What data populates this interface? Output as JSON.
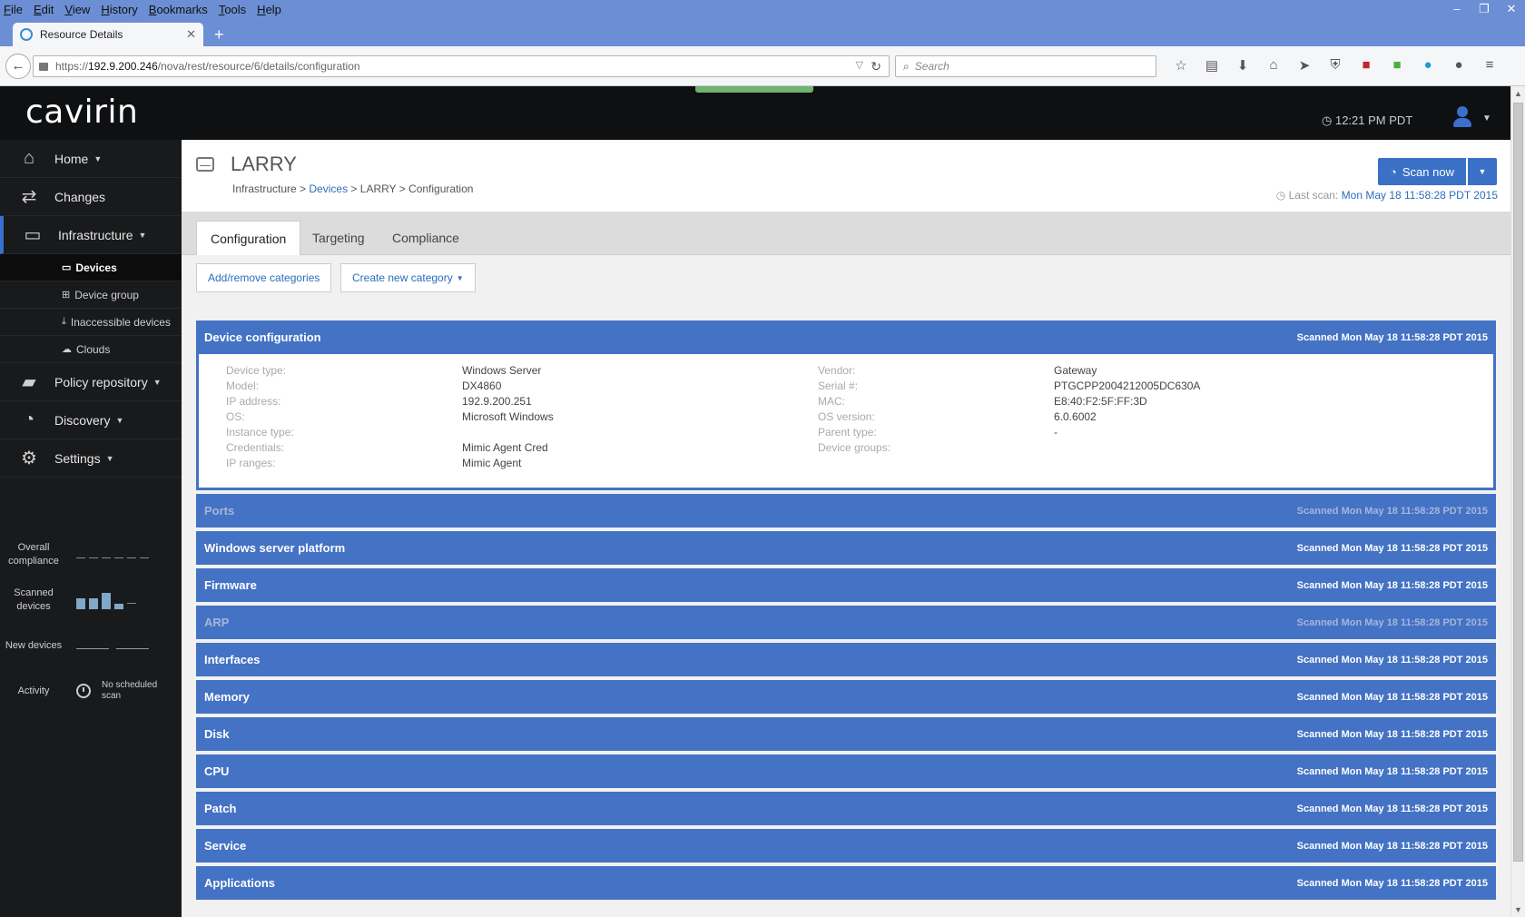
{
  "browser": {
    "menu": [
      "File",
      "Edit",
      "View",
      "History",
      "Bookmarks",
      "Tools",
      "Help"
    ],
    "tab_title": "Resource Details",
    "url_prefix": "https://",
    "url_host": "192.9.200.246",
    "url_path": "/nova/rest/resource/6/details/configuration",
    "search_placeholder": "Search"
  },
  "app": {
    "logo": "cavirin",
    "clock": "12:21 PM PDT"
  },
  "sidebar": {
    "items": [
      {
        "label": "Home",
        "icon": "home-icon"
      },
      {
        "label": "Changes",
        "icon": "changes-icon"
      },
      {
        "label": "Infrastructure",
        "icon": "hdd-icon"
      },
      {
        "label": "Policy repository",
        "icon": "folder-icon"
      },
      {
        "label": "Discovery",
        "icon": "rss-icon"
      },
      {
        "label": "Settings",
        "icon": "gear-icon"
      }
    ],
    "subitems": [
      {
        "label": "Devices",
        "icon": "hdd-icon"
      },
      {
        "label": "Device group",
        "icon": "sitemap-icon"
      },
      {
        "label": "Inaccessible devices",
        "icon": "download-icon"
      },
      {
        "label": "Clouds",
        "icon": "cloud-icon"
      }
    ],
    "stats": {
      "overall": "Overall compliance",
      "scanned": "Scanned devices",
      "new": "New devices",
      "activity": "Activity",
      "schedule": "No scheduled scan"
    }
  },
  "page": {
    "title": "LARRY",
    "crumb_1": "Infrastructure",
    "crumb_2": "Devices",
    "crumb_3": "LARRY",
    "crumb_4": "Configuration",
    "scan_button": "Scan now",
    "last_scan_label": "Last scan:",
    "last_scan_value": "Mon May 18 11:58:28 PDT 2015",
    "tabs": [
      "Configuration",
      "Targeting",
      "Compliance"
    ],
    "add_remove": "Add/remove categories",
    "create_category": "Create new category"
  },
  "device": {
    "left": [
      {
        "k": "Device type:",
        "v": "Windows Server"
      },
      {
        "k": "Model:",
        "v": "DX4860"
      },
      {
        "k": "IP address:",
        "v": "192.9.200.251"
      },
      {
        "k": "OS:",
        "v": "Microsoft Windows"
      },
      {
        "k": "Instance type:",
        "v": ""
      },
      {
        "k": "Credentials:",
        "v": "Mimic Agent Cred"
      },
      {
        "k": "IP ranges:",
        "v": "Mimic Agent"
      }
    ],
    "right": [
      {
        "k": "Vendor:",
        "v": "Gateway"
      },
      {
        "k": "Serial #:",
        "v": "PTGCPP2004212005DC630A"
      },
      {
        "k": "MAC:",
        "v": "E8:40:F2:5F:FF:3D"
      },
      {
        "k": "OS version:",
        "v": "6.0.6002"
      },
      {
        "k": "Parent type:",
        "v": "-"
      },
      {
        "k": "Device groups:",
        "v": ""
      }
    ]
  },
  "sections": [
    {
      "name": "Device configuration",
      "scanned": "Scanned Mon May 18 11:58:28 PDT 2015",
      "dim": false
    },
    {
      "name": "Ports",
      "scanned": "Scanned Mon May 18 11:58:28 PDT 2015",
      "dim": true
    },
    {
      "name": "Windows server platform",
      "scanned": "Scanned Mon May 18 11:58:28 PDT 2015",
      "dim": false
    },
    {
      "name": "Firmware",
      "scanned": "Scanned Mon May 18 11:58:28 PDT 2015",
      "dim": false
    },
    {
      "name": "ARP",
      "scanned": "Scanned Mon May 18 11:58:28 PDT 2015",
      "dim": true
    },
    {
      "name": "Interfaces",
      "scanned": "Scanned Mon May 18 11:58:28 PDT 2015",
      "dim": false
    },
    {
      "name": "Memory",
      "scanned": "Scanned Mon May 18 11:58:28 PDT 2015",
      "dim": false
    },
    {
      "name": "Disk",
      "scanned": "Scanned Mon May 18 11:58:28 PDT 2015",
      "dim": false
    },
    {
      "name": "CPU",
      "scanned": "Scanned Mon May 18 11:58:28 PDT 2015",
      "dim": false
    },
    {
      "name": "Patch",
      "scanned": "Scanned Mon May 18 11:58:28 PDT 2015",
      "dim": false
    },
    {
      "name": "Service",
      "scanned": "Scanned Mon May 18 11:58:28 PDT 2015",
      "dim": false
    },
    {
      "name": "Applications",
      "scanned": "Scanned Mon May 18 11:58:28 PDT 2015",
      "dim": false
    }
  ]
}
